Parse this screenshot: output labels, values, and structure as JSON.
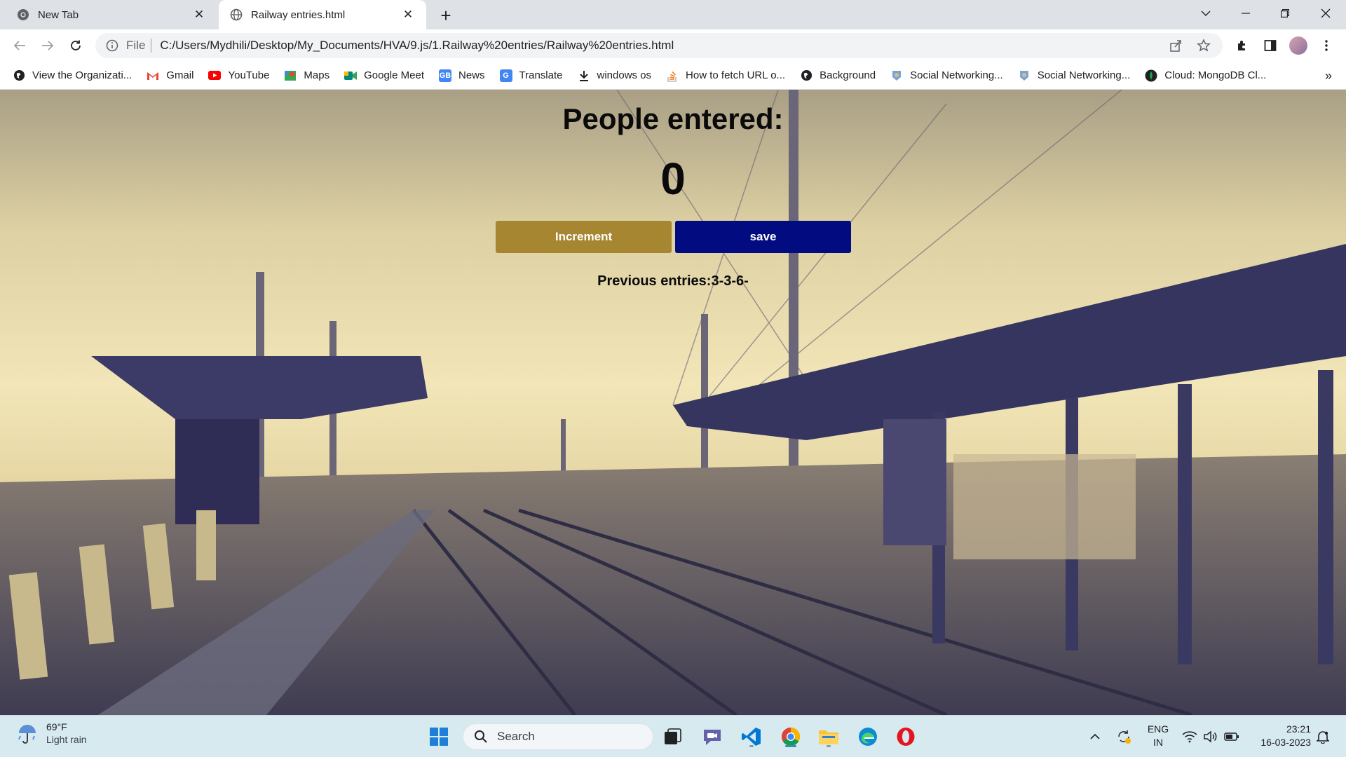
{
  "browser": {
    "tabs": [
      {
        "title": "New Tab",
        "active": false,
        "icon": "chrome-icon"
      },
      {
        "title": "Railway entries.html",
        "active": true,
        "icon": "globe-icon"
      }
    ],
    "address": {
      "scheme_label": "File",
      "url": "C:/Users/Mydhili/Desktop/My_Documents/HVA/9.js/1.Railway%20entries/Railway%20entries.html"
    },
    "bookmarks": [
      {
        "label": "View the Organizati...",
        "icon": "globe-icon"
      },
      {
        "label": "Gmail",
        "icon": "gmail-icon"
      },
      {
        "label": "YouTube",
        "icon": "youtube-icon"
      },
      {
        "label": "Maps",
        "icon": "maps-icon"
      },
      {
        "label": "Google Meet",
        "icon": "meet-icon"
      },
      {
        "label": "News",
        "icon": "news-icon"
      },
      {
        "label": "Translate",
        "icon": "translate-icon"
      },
      {
        "label": "windows os",
        "icon": "download-icon"
      },
      {
        "label": "How to fetch URL o...",
        "icon": "stackoverflow-icon"
      },
      {
        "label": "Background",
        "icon": "globe-icon"
      },
      {
        "label": "Social Networking...",
        "icon": "social-icon"
      },
      {
        "label": "Social Networking...",
        "icon": "social-icon"
      },
      {
        "label": "Cloud: MongoDB Cl...",
        "icon": "mongodb-icon"
      }
    ]
  },
  "page": {
    "heading": "People entered:",
    "count": "0",
    "increment_label": "Increment",
    "save_label": "save",
    "previous_entries": "Previous entries:3-3-6-"
  },
  "taskbar": {
    "weather": {
      "temp": "69°F",
      "desc": "Light rain"
    },
    "search_placeholder": "Search",
    "lang_line1": "ENG",
    "lang_line2": "IN",
    "time": "23:21",
    "date": "16-03-2023"
  },
  "colors": {
    "increment_bg": "#a68630",
    "save_bg": "#020b80"
  }
}
